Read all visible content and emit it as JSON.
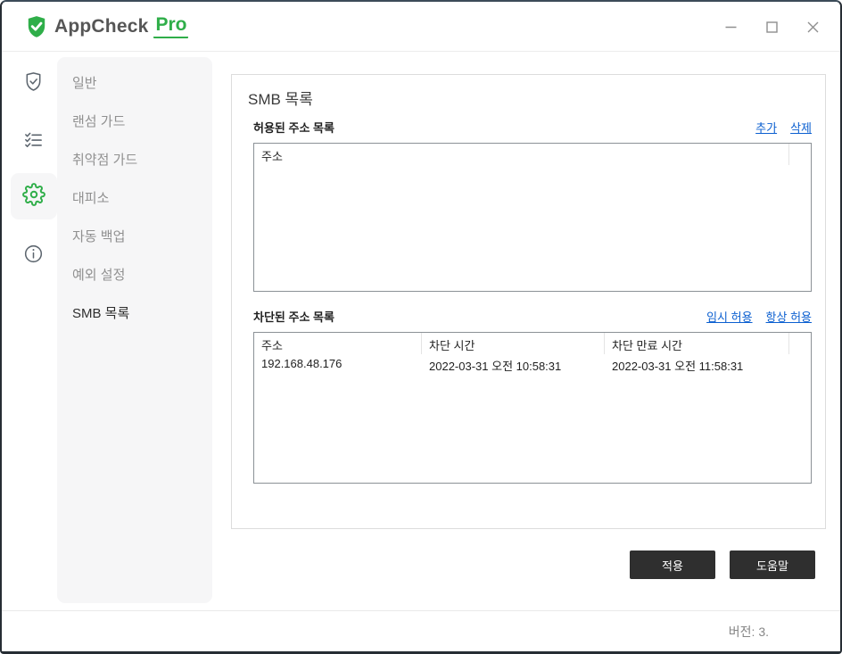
{
  "titlebar": {
    "brand": "AppCheck",
    "brand_suffix": "Pro"
  },
  "window_controls": {
    "icons": [
      {
        "name": "minimize-icon",
        "glyph": "–"
      },
      {
        "name": "maximize-icon",
        "glyph": "□"
      },
      {
        "name": "close-icon",
        "glyph": "✕"
      }
    ]
  },
  "nav_rail": {
    "icons": [
      {
        "name": "shield-check-icon",
        "active": false
      },
      {
        "name": "checklist-icon",
        "active": false
      },
      {
        "name": "gear-icon",
        "active": true
      },
      {
        "name": "info-icon",
        "active": false
      }
    ]
  },
  "sidebar": {
    "items": [
      {
        "label": "일반",
        "active": false
      },
      {
        "label": "랜섬 가드",
        "active": false
      },
      {
        "label": "취약점 가드",
        "active": false
      },
      {
        "label": "대피소",
        "active": false
      },
      {
        "label": "자동 백업",
        "active": false
      },
      {
        "label": "예외 설정",
        "active": false
      },
      {
        "label": "SMB 목록",
        "active": true
      }
    ]
  },
  "main": {
    "title": "SMB 목록",
    "allowed": {
      "label": "허용된 주소 목록",
      "actions": [
        {
          "label": "추가"
        },
        {
          "label": "삭제"
        }
      ],
      "columns": [
        "주소"
      ],
      "rows": []
    },
    "blocked": {
      "label": "차단된 주소 목록",
      "actions": [
        {
          "label": "임시 허용"
        },
        {
          "label": "항상 허용"
        }
      ],
      "columns": [
        "주소",
        "차단 시간",
        "차단 만료 시간"
      ],
      "rows": [
        [
          "192.168.48.176",
          "2022-03-31 오전 10:58:31",
          "2022-03-31 오전 11:58:31"
        ]
      ]
    },
    "buttons": [
      {
        "label": "적용"
      },
      {
        "label": "도움말"
      }
    ]
  },
  "footer": {
    "version": "버전: 3."
  },
  "colors": {
    "brand_green": "#2fae49",
    "link_blue": "#0b5fd0",
    "button_dark": "#2f2f2f"
  }
}
